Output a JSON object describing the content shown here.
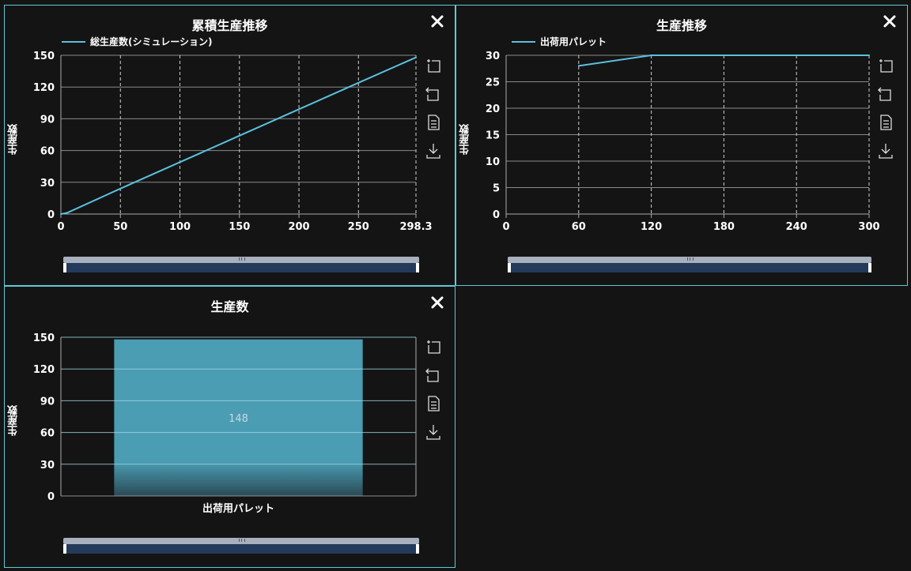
{
  "panels": {
    "cumulative": {
      "title": "累積生産推移",
      "ylabel": "生産数",
      "legend": "総生産数(シミュレーション)"
    },
    "trend": {
      "title": "生産推移",
      "ylabel": "生産数",
      "legend": "出荷用パレット"
    },
    "count": {
      "title": "生産数",
      "ylabel": "生産数"
    }
  },
  "icons": {
    "close": "close-icon",
    "tools": [
      "zoom-in-icon",
      "zoom-reset-icon",
      "data-view-icon",
      "download-icon"
    ]
  },
  "colors": {
    "line": "#5bc0de",
    "bar": "#4a9db3",
    "border": "#5fc9d6",
    "background": "#141414"
  },
  "chart_data": [
    {
      "type": "line",
      "title": "累積生産推移",
      "ylabel": "生産数",
      "xlim": [
        0,
        298.3
      ],
      "ylim": [
        0,
        150
      ],
      "xticks": [
        0,
        50,
        100,
        150,
        200,
        250,
        298.3
      ],
      "yticks": [
        0,
        30,
        60,
        90,
        120,
        150
      ],
      "legend": "top-left",
      "grid": true,
      "series": [
        {
          "name": "総生産数(シミュレーション)",
          "x": [
            0,
            5,
            50,
            100,
            150,
            200,
            250,
            298.3
          ],
          "y": [
            0,
            1,
            24,
            49,
            74,
            99,
            124,
            148
          ]
        }
      ]
    },
    {
      "type": "line",
      "title": "生産推移",
      "ylabel": "生産数",
      "xlim": [
        0,
        300
      ],
      "ylim": [
        0,
        30
      ],
      "xticks": [
        0,
        60,
        120,
        180,
        240,
        300
      ],
      "yticks": [
        0,
        5,
        10,
        15,
        20,
        25,
        30
      ],
      "legend": "top-left",
      "grid": true,
      "series": [
        {
          "name": "出荷用パレット",
          "x": [
            60,
            120,
            180,
            240,
            300
          ],
          "y": [
            28,
            30,
            30,
            30,
            30
          ]
        }
      ]
    },
    {
      "type": "bar",
      "title": "生産数",
      "ylabel": "生産数",
      "categories": [
        "出荷用パレット"
      ],
      "values": [
        148
      ],
      "data_labels": [
        "148"
      ],
      "ylim": [
        0,
        150
      ],
      "yticks": [
        0,
        30,
        60,
        90,
        120,
        150
      ],
      "grid": true
    }
  ]
}
